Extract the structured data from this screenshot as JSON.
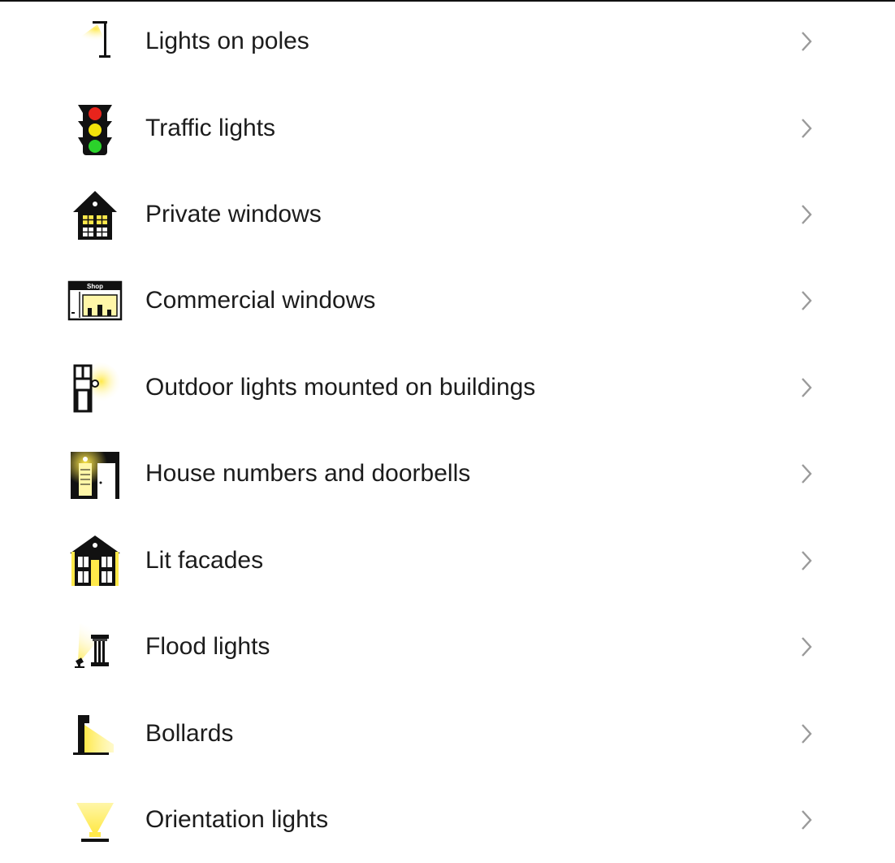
{
  "items": [
    {
      "label": "Lights on poles",
      "icon": "pole-light-icon"
    },
    {
      "label": "Traffic lights",
      "icon": "traffic-light-icon"
    },
    {
      "label": "Private windows",
      "icon": "house-windows-icon"
    },
    {
      "label": "Commercial windows",
      "icon": "shop-window-icon"
    },
    {
      "label": "Outdoor lights mounted on buildings",
      "icon": "wall-lamp-icon"
    },
    {
      "label": "House numbers and doorbells",
      "icon": "doorbell-icon"
    },
    {
      "label": "Lit facades",
      "icon": "lit-facade-icon"
    },
    {
      "label": "Flood lights",
      "icon": "flood-light-icon"
    },
    {
      "label": "Bollards",
      "icon": "bollard-icon"
    },
    {
      "label": "Orientation lights",
      "icon": "orientation-light-icon"
    }
  ],
  "shop_sign_text": "Shop",
  "colors": {
    "glow": "#ffe94a",
    "glow_light": "#fff6a8",
    "text": "#1c1c1c",
    "chevron": "#9a9a9a",
    "traffic_red": "#e8241c",
    "traffic_yellow": "#f2e20a",
    "traffic_green": "#2bd22b"
  }
}
